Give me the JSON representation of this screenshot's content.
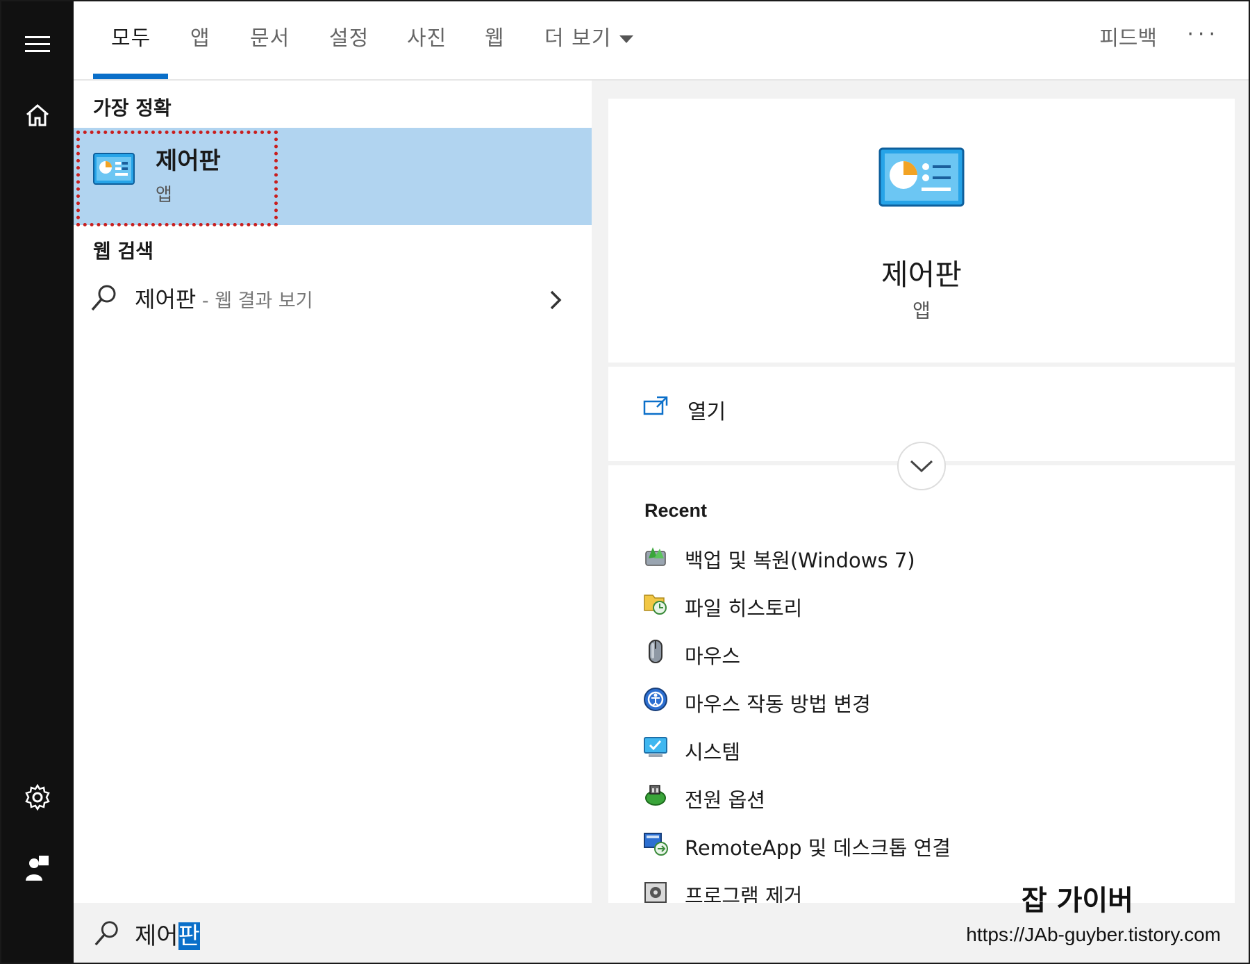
{
  "tabs": [
    {
      "label": "모두"
    },
    {
      "label": "앱"
    },
    {
      "label": "문서"
    },
    {
      "label": "설정"
    },
    {
      "label": "사진"
    },
    {
      "label": "웹"
    },
    {
      "label": "더 보기"
    }
  ],
  "header": {
    "feedback_label": "피드백",
    "more_options_label": "···"
  },
  "results": {
    "best_match_title": "가장 정확",
    "best_match": {
      "name": "제어판",
      "type": "앱"
    },
    "web_search_title": "웹 검색",
    "web_search": {
      "query": "제어판",
      "hint": " - 웹 결과 보기"
    }
  },
  "detail": {
    "app_name": "제어판",
    "app_type": "앱",
    "open_label": "열기",
    "recent_title": "Recent",
    "recent_items": [
      {
        "label": "백업 및 복원(Windows 7)",
        "icon": "backup-restore-icon"
      },
      {
        "label": "파일 히스토리",
        "icon": "file-history-icon"
      },
      {
        "label": "마우스",
        "icon": "mouse-icon"
      },
      {
        "label": "마우스 작동 방법 변경",
        "icon": "ease-of-access-icon"
      },
      {
        "label": "시스템",
        "icon": "system-icon"
      },
      {
        "label": "전원 옵션",
        "icon": "power-options-icon"
      },
      {
        "label": "RemoteApp 및 데스크톱 연결",
        "icon": "remoteapp-icon"
      },
      {
        "label": "프로그램 제거",
        "icon": "programs-icon"
      }
    ]
  },
  "search": {
    "typed_prefix": "제어",
    "selected_text": "판"
  },
  "watermark": {
    "title": "잡 가이버",
    "url": "https://JAb-guyber.tistory.com"
  },
  "colors": {
    "accent": "#0a6fc9",
    "selection_bg": "#b1d4f0",
    "rail_bg": "#111111",
    "highlight_box": "#c81e1e"
  }
}
